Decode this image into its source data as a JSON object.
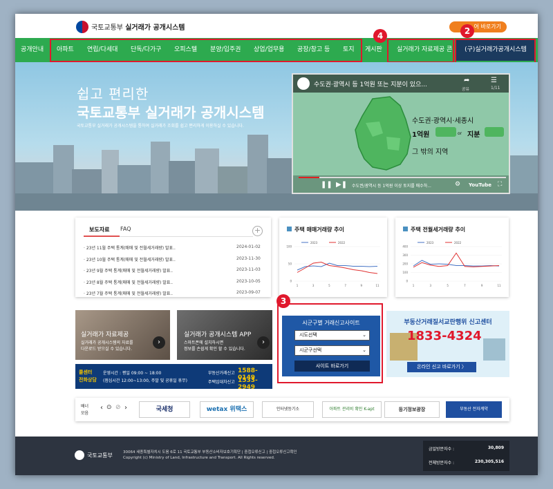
{
  "header": {
    "title_prefix": "국토교통부",
    "title_main": "실거래가 공개시스템",
    "shortcut": "어 바로가기"
  },
  "nav": {
    "items": [
      "공개안내",
      "아파트",
      "연립/다세대",
      "단독/다가구",
      "오피스텔",
      "분양/입주권",
      "상업/업무용",
      "공장/창고 등",
      "토지",
      "게시판",
      "실거래가 자료제공 콘",
      "(구)실거래가공개시스템"
    ]
  },
  "badges": [
    "1",
    "2",
    "3",
    "4"
  ],
  "hero": {
    "line1": "쉽고 편리한",
    "line2": "국토교통부 실거래가 공개시스템",
    "desc": "국토교통부 실거래가 공개시스템을 통하여 실거래가 조회를 쉽고 편리하게 이용하실 수 있습니다."
  },
  "video": {
    "title": "수도권·광역시 등 1억원 또는 지분이 있으...",
    "share": "공유",
    "playlist": "1/11",
    "text1": "수도권·광역시·세종시",
    "text2a": "1억원",
    "text2b": "or",
    "text2c": "지분",
    "text3": "그 밖의 지역",
    "caption": "수도권/광역시 등 1억원 이상 토지를 매수하...",
    "brand": "YouTube"
  },
  "news": {
    "tab1": "보도자료",
    "tab2": "FAQ",
    "items": [
      {
        "title": "23년 11월 주택 통계(매매 및 전월세거래량) 발표..",
        "date": "2024-01-02"
      },
      {
        "title": "23년 10월 주택 통계(매매 및 전월세거래량) 발표..",
        "date": "2023-11-30"
      },
      {
        "title": "23년 9월 주택 통계(매매 및 전월세거래량) 발표..",
        "date": "2023-11-03"
      },
      {
        "title": "23년 8월 주택 통계(매매 및 전월세거래량) 발표..",
        "date": "2023-10-05"
      },
      {
        "title": "23년 7월 주택 통계(매매 및 전월세거래량) 발표..",
        "date": "2023-09-07"
      }
    ]
  },
  "chart_data": [
    {
      "type": "line",
      "title": "주택 매매거래량 추이",
      "categories": [
        "1",
        "2",
        "3",
        "4",
        "5",
        "6",
        "7",
        "8",
        "9",
        "10",
        "11"
      ],
      "ylim": [
        0,
        100
      ],
      "yticks": [
        "100",
        "50",
        "0"
      ],
      "series": [
        {
          "name": "2023",
          "color": "#4472c4",
          "values": [
            32,
            42,
            44,
            42,
            52,
            45,
            45,
            43,
            43,
            42,
            43
          ]
        },
        {
          "name": "2022",
          "color": "#e03030",
          "values": [
            25,
            38,
            52,
            55,
            45,
            42,
            38,
            33,
            30,
            25,
            22
          ]
        }
      ]
    },
    {
      "type": "line",
      "title": "주택 전월세거래량 추이",
      "categories": [
        "1",
        "2",
        "3",
        "4",
        "5",
        "6",
        "7",
        "8",
        "9",
        "10",
        "11"
      ],
      "ylim": [
        0,
        400
      ],
      "yticks": [
        "400",
        "300",
        "200",
        "100",
        "0"
      ],
      "series": [
        {
          "name": "2023",
          "color": "#4472c4",
          "values": [
            175,
            240,
            195,
            200,
            195,
            180,
            180,
            175,
            175,
            180,
            175
          ]
        },
        {
          "name": "2022",
          "color": "#e03030",
          "values": [
            160,
            215,
            185,
            170,
            180,
            325,
            170,
            165,
            170,
            175,
            180
          ]
        }
      ]
    }
  ],
  "data_banner": {
    "title": "실거래가 자료제공",
    "desc1": "실거래가 공개시스템의 자료를",
    "desc2": "다운로드 받으실 수 있습니다."
  },
  "app_banner": {
    "title": "실거래가 공개시스템 APP",
    "desc1": "스마트폰에 설치하시면",
    "desc2": "정보를 손쉽게 확인 할 수 있습니다."
  },
  "call_center": {
    "label1": "콜센터",
    "label2": "전화상담",
    "hours1": "운영시간 : 평일 09:00 ~ 18:00",
    "hours2": "(점심시간 12:00~13:00, 주말 및 공휴일 휴무)",
    "line1_label": "부동산거래신고",
    "line1_num": "1588-0149",
    "line2_label": "주택임대차신고",
    "line2_num": "1533-2949"
  },
  "report_box": {
    "title": "시군구별 거래신고사이트",
    "select1": "시도선택",
    "select2": "시군구선택",
    "button": "사이트 바로가기"
  },
  "promo": {
    "title": "부동산거래질서교란행위 신고센터",
    "phone": "1833-4324",
    "link": "온라인 신고 바로가기 〉"
  },
  "banner_zone": {
    "label1": "배너",
    "label2": "모음",
    "logos": [
      "국세청",
      "wetax 위택스",
      "인터넷등기소",
      "아파트 관리비 확인 K-apt",
      "등기정보광장",
      "부동산 전자계약"
    ]
  },
  "footer": {
    "org": "국토교통부",
    "addr": "30064 세종특별자치시 도움 6로 11 국토교통부 부동산소비자보호기획단 | 중첩오류신고 | 중첩오류신고확인",
    "copy": "Copyright (c) Ministry of Land, Infrastructure and Transport. All Rights reserved.",
    "today_label": "금일방문자수 :",
    "today": "30,809",
    "total_label": "전체방문자수 :",
    "total": "230,305,516"
  }
}
